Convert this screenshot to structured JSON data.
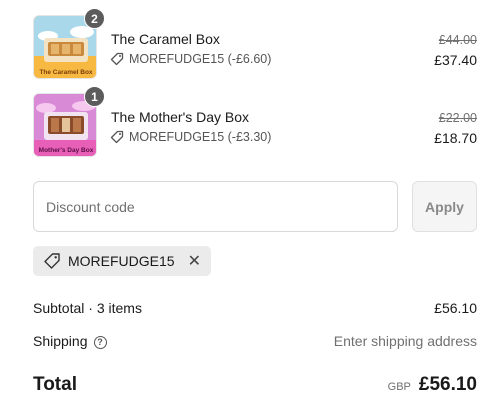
{
  "items": [
    {
      "name": "The Caramel Box",
      "quantity": "2",
      "discount_code": "MOREFUDGE15 (-£6.60)",
      "price_original": "£44.00",
      "price_final": "£37.40",
      "thumb_label": "The Caramel Box",
      "thumb_bg": "#f7b941"
    },
    {
      "name": "The Mother's Day Box",
      "quantity": "1",
      "discount_code": "MOREFUDGE15 (-£3.30)",
      "price_original": "£22.00",
      "price_final": "£18.70",
      "thumb_label": "Mother's Day Box",
      "thumb_bg": "#e85fb8"
    }
  ],
  "discount": {
    "placeholder": "Discount code",
    "apply_label": "Apply",
    "applied_code": "MOREFUDGE15"
  },
  "summary": {
    "subtotal_label": "Subtotal · 3 items",
    "subtotal_value": "£56.10",
    "shipping_label": "Shipping",
    "shipping_value": "Enter shipping address",
    "total_label": "Total",
    "currency": "GBP",
    "total_value": "£56.10"
  }
}
